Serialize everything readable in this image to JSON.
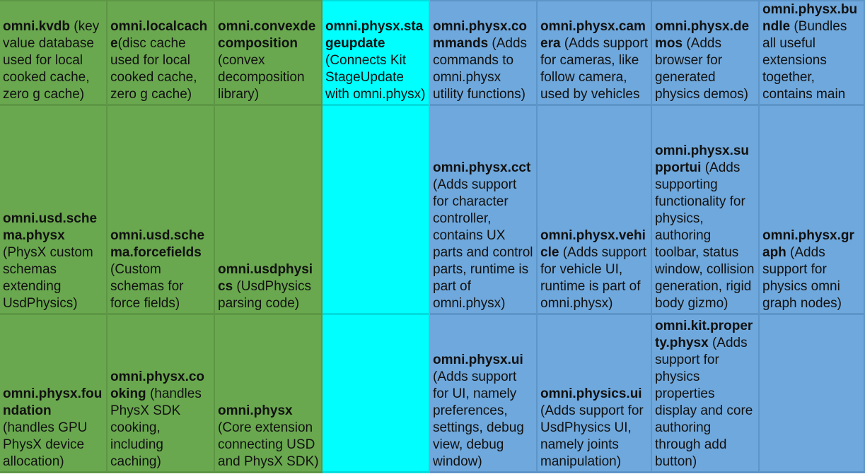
{
  "colors": {
    "green": "#6aa84f",
    "cyan": "#00ffff",
    "blue": "#6fa8dc"
  },
  "rows": [
    [
      {
        "name": "omni.kvdb",
        "desc": " (key value database used for local cooked cache, zero g cache)",
        "group": "green"
      },
      {
        "name": "omni.localcache",
        "desc": "(disc cache used for local cooked cache, zero g cache)",
        "group": "green"
      },
      {
        "name": "omni.convexdecomposition",
        "desc": " (convex decomposition library)",
        "group": "green"
      },
      {
        "name": "omni.physx.stageupdate",
        "desc": " (Connects Kit StageUpdate with omni.physx)",
        "group": "cyan"
      },
      {
        "name": "omni.physx.commands",
        "desc": " (Adds commands to omni.physx utility functions)",
        "group": "blue"
      },
      {
        "name": "omni.physx.camera",
        "desc": " (Adds support for cameras, like follow camera, used by vehicles",
        "group": "blue"
      },
      {
        "name": "omni.physx.demos",
        "desc": " (Adds browser for generated physics demos)",
        "group": "blue"
      },
      {
        "name": "omni.physx.bundle",
        "desc": " (Bundles all useful extensions together, contains main",
        "group": "blue"
      }
    ],
    [
      {
        "name": "omni.usd.schema.physx",
        "desc": " (PhysX custom schemas extending UsdPhysics)",
        "group": "green"
      },
      {
        "name": "omni.usd.schema.forcefields",
        "desc": " (Custom schemas for force fields)",
        "group": "green"
      },
      {
        "name": "omni.usdphysics",
        "desc": " (UsdPhysics parsing code)",
        "group": "green"
      },
      {
        "name": "",
        "desc": "",
        "group": "cyan"
      },
      {
        "name": "omni.physx.cct",
        "desc": "(Adds support for character controller, contains UX parts and control parts, runtime is part of omni.physx)",
        "group": "blue"
      },
      {
        "name": "omni.physx.vehicle",
        "desc": " (Adds support for vehicle UI, runtime is part of omni.physx)",
        "group": "blue"
      },
      {
        "name": "omni.physx.supportui",
        "desc": " (Adds supporting functionality for physics, authoring toolbar, status window, collision generation, rigid body gizmo)",
        "group": "blue"
      },
      {
        "name": "omni.physx.graph",
        "desc": " (Adds support for physics omni graph nodes)",
        "group": "blue"
      }
    ],
    [
      {
        "name": "omni.physx.foundation",
        "desc": " (handles GPU PhysX device allocation)",
        "group": "green"
      },
      {
        "name": "omni.physx.cooking",
        "desc": " (handles PhysX SDK cooking, including caching)",
        "group": "green"
      },
      {
        "name": "omni.physx",
        "desc": " (Core extension connecting USD and PhysX SDK)",
        "group": "green"
      },
      {
        "name": "",
        "desc": "",
        "group": "cyan"
      },
      {
        "name": "omni.physx.ui",
        "desc": " (Adds support for UI, namely preferences, settings, debug view, debug window)",
        "group": "blue"
      },
      {
        "name": "omni.physics.ui",
        "desc": " (Adds support for UsdPhysics UI, namely joints manipulation)",
        "group": "blue"
      },
      {
        "name": "omni.kit.property.physx",
        "desc": " (Adds support for physics properties display and core authoring through add button)",
        "group": "blue"
      },
      {
        "name": "",
        "desc": "",
        "group": "blue"
      }
    ]
  ]
}
